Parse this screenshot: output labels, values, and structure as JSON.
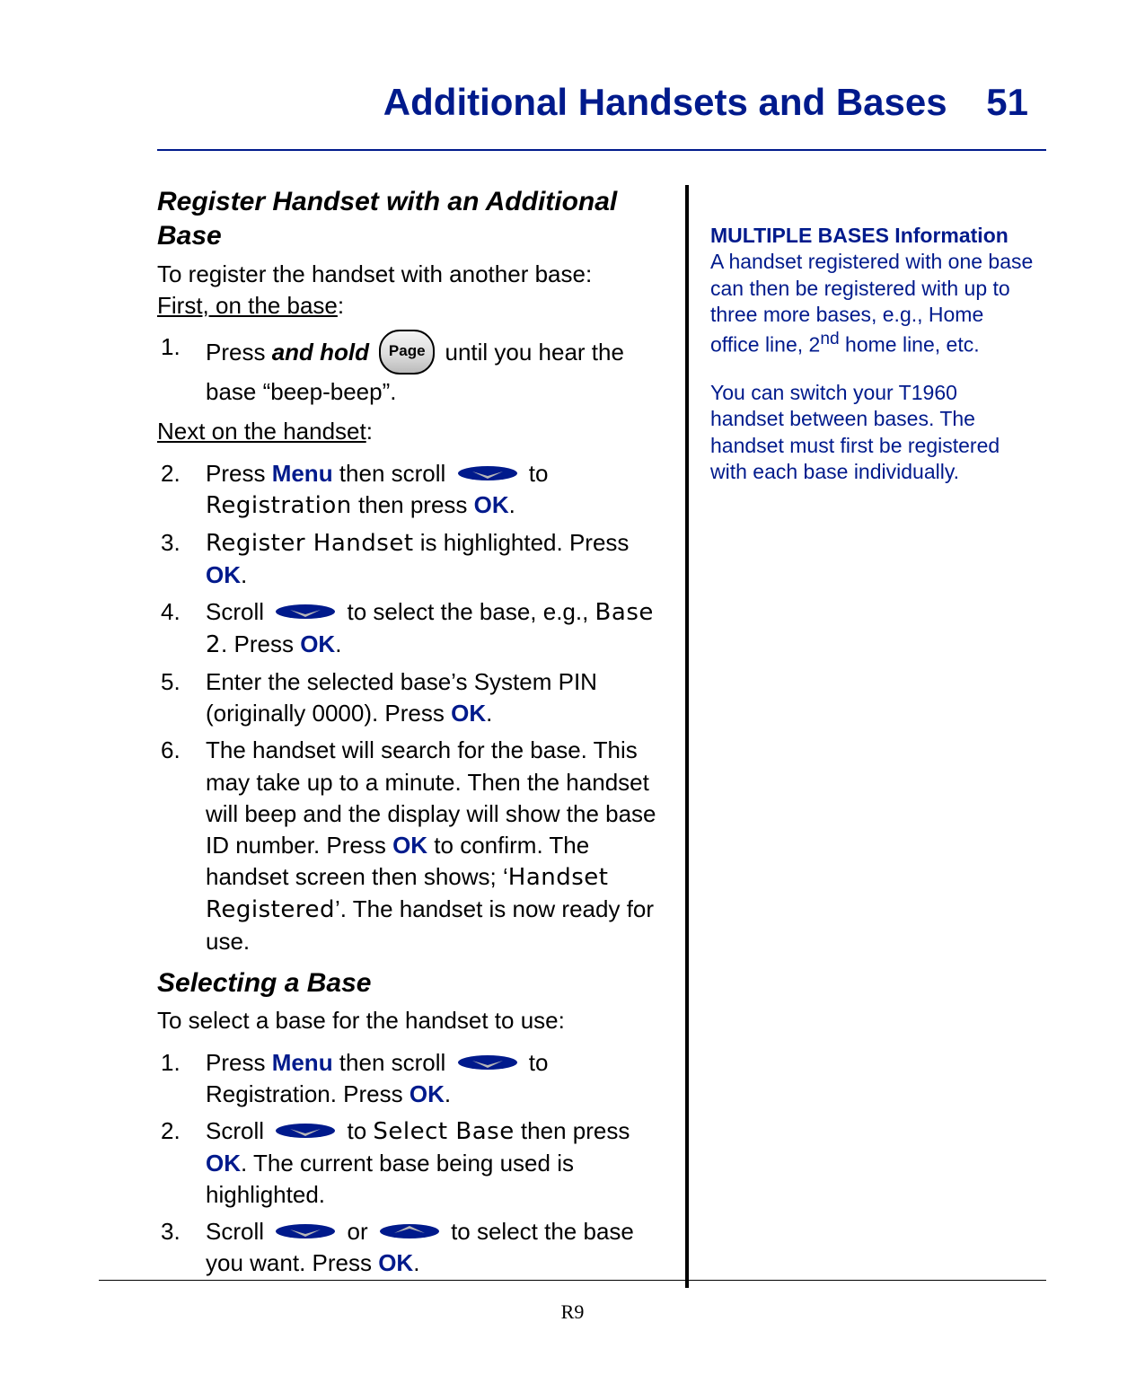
{
  "header": {
    "title": "Additional Handsets and Bases",
    "page_number": "51"
  },
  "footer": "R9",
  "section1": {
    "heading": "Register Handset with an Additional Base",
    "intro": "To register the handset with another base:",
    "phase1": "First, on the base",
    "step1_a": "Press ",
    "step1_hold": "and hold",
    "step1_b": " until you hear the base “beep-beep”.",
    "page_btn": "Page",
    "phase2": "Next on the handset",
    "step2_a": "Press ",
    "menu": "Menu",
    "step2_b": " then scroll ",
    "step2_c": " to ",
    "registration": "Registration",
    "step2_d": " then press ",
    "ok": "OK",
    "step3_a": "Register Handset",
    "step3_b": " is highlighted.  Press ",
    "step4_a": "Scroll ",
    "step4_b": " to select the base, e.g., ",
    "base2": "Base 2",
    "step4_c": ".  Press ",
    "step5_a": "Enter the selected base’s System PIN (originally 0000).  Press ",
    "step6_a": "The handset will search for the base.  This may take up to a minute.  Then the handset will beep and the display will show the base ID number.  Press ",
    "step6_b": " to confirm.  The handset screen then shows; ‘",
    "handset_reg": "Handset Registered",
    "step6_c": "’.  The handset is now ready for use."
  },
  "section2": {
    "heading": "Selecting a Base",
    "intro": "To select a base for the handset to use:",
    "s1_a": "Press ",
    "s1_b": " then scroll ",
    "s1_c": " to Registration.  Press ",
    "s2_a": "Scroll ",
    "s2_b": " to ",
    "select_base": "Select Base",
    "s2_c": " then press ",
    "s2_d": ".  The current base being used is highlighted.",
    "s3_a": "Scroll ",
    "s3_or": " or ",
    "s3_b": " to select the base you want.  Press "
  },
  "sidebar": {
    "title": "MULTIPLE BASES Information",
    "p1a": "A handset registered with one base can then be registered with up to three more bases, e.g., Home office line, 2",
    "p1sup": "nd",
    "p1b": " home line, etc.",
    "p2": "You can switch your T1960 handset between bases.  The handset must first be registered with each base individually."
  },
  "icons": {
    "scroll_down": "scroll-down-icon",
    "scroll_up": "scroll-up-icon"
  }
}
